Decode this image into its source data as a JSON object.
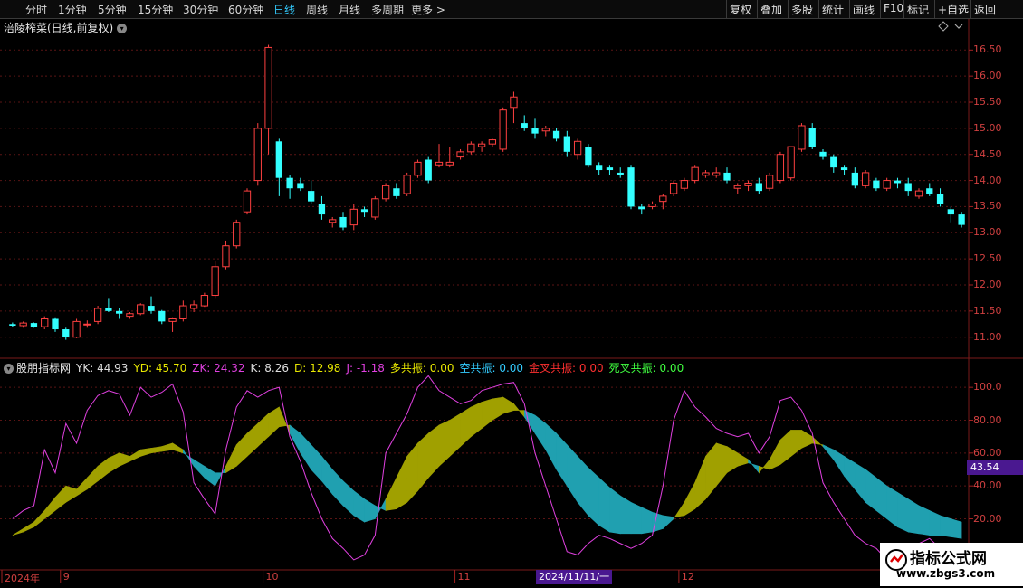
{
  "toolbar": {
    "periods": [
      "分时",
      "1分钟",
      "5分钟",
      "15分钟",
      "30分钟",
      "60分钟",
      "日线",
      "周线",
      "月线",
      "多周期",
      "更多 >"
    ],
    "active_period": "日线",
    "right_buttons": [
      "复权",
      "叠加",
      "多股",
      "统计",
      "画线",
      "F10",
      "标记",
      "+自选",
      "返回"
    ]
  },
  "chart_header": {
    "stock_title": "涪陵榨菜(日线,前复权)"
  },
  "indicator_header": {
    "name": "股朋指标网",
    "items": [
      {
        "label": "YK: 44.93",
        "color": "#e0e0e0"
      },
      {
        "label": "YD: 45.70",
        "color": "#e8e800"
      },
      {
        "label": "ZK: 24.32",
        "color": "#e040e0"
      },
      {
        "label": "K: 8.26",
        "color": "#e0e0e0"
      },
      {
        "label": "D: 12.98",
        "color": "#e8e800"
      },
      {
        "label": "J: -1.18",
        "color": "#e040e0"
      },
      {
        "label": "多共振: 0.00",
        "color": "#e8e800"
      },
      {
        "label": "空共振: 0.00",
        "color": "#33ccff"
      },
      {
        "label": "金叉共振: 0.00",
        "color": "#ff3030"
      },
      {
        "label": "死叉共振: 0.00",
        "color": "#40ff40"
      }
    ],
    "last_value": "43.54"
  },
  "price_axis": [
    "16.50",
    "16.00",
    "15.50",
    "15.00",
    "14.50",
    "14.00",
    "13.50",
    "13.00",
    "12.50",
    "12.00",
    "11.50",
    "11.00"
  ],
  "indicator_axis": [
    "100.0",
    "80.00",
    "60.00",
    "40.00",
    "20.00"
  ],
  "date_axis": {
    "labels": [
      {
        "text": "2024年",
        "bar": 0
      },
      {
        "text": "9",
        "bar": 5
      },
      {
        "text": "10",
        "bar": 24
      },
      {
        "text": "11",
        "bar": 42
      },
      {
        "text": "12",
        "bar": 63
      }
    ],
    "cursor_date": "2024/11/11/一"
  },
  "watermark": {
    "title": "指标公式网",
    "url": "www.zbgs3.com"
  },
  "colors": {
    "up": "#ff4040",
    "down": "#33ffff",
    "grid": "#5a1414",
    "fill_bull": "#a0a000",
    "fill_bear": "#20a0b0",
    "kline": "#e040e0"
  },
  "chart_data": {
    "type": "candlestick",
    "title": "涪陵榨菜(日线,前复权)",
    "ylim": [
      10.7,
      16.8
    ],
    "candles": [
      [
        11.25,
        11.28,
        11.2,
        11.22
      ],
      [
        11.22,
        11.3,
        11.18,
        11.27
      ],
      [
        11.27,
        11.28,
        11.18,
        11.2
      ],
      [
        11.2,
        11.4,
        11.15,
        11.35
      ],
      [
        11.35,
        11.38,
        11.1,
        11.15
      ],
      [
        11.15,
        11.18,
        10.95,
        11.0
      ],
      [
        11.0,
        11.35,
        10.98,
        11.3
      ],
      [
        11.25,
        11.32,
        11.18,
        11.25
      ],
      [
        11.3,
        11.6,
        11.25,
        11.55
      ],
      [
        11.55,
        11.75,
        11.48,
        11.5
      ],
      [
        11.5,
        11.55,
        11.35,
        11.45
      ],
      [
        11.4,
        11.48,
        11.35,
        11.45
      ],
      [
        11.45,
        11.65,
        11.42,
        11.62
      ],
      [
        11.6,
        11.78,
        11.45,
        11.5
      ],
      [
        11.5,
        11.52,
        11.25,
        11.3
      ],
      [
        11.3,
        11.38,
        11.1,
        11.35
      ],
      [
        11.35,
        11.7,
        11.3,
        11.6
      ],
      [
        11.55,
        11.7,
        11.48,
        11.62
      ],
      [
        11.6,
        11.85,
        11.58,
        11.8
      ],
      [
        11.8,
        12.45,
        11.75,
        12.35
      ],
      [
        12.35,
        12.85,
        12.3,
        12.75
      ],
      [
        12.75,
        13.25,
        12.7,
        13.2
      ],
      [
        13.4,
        13.85,
        13.35,
        13.8
      ],
      [
        14.0,
        15.1,
        13.9,
        15.0
      ],
      [
        15.0,
        16.6,
        14.5,
        16.55
      ],
      [
        14.75,
        14.8,
        13.7,
        14.05
      ],
      [
        14.05,
        14.1,
        13.65,
        13.85
      ],
      [
        13.95,
        14.05,
        13.8,
        13.85
      ],
      [
        13.8,
        14.0,
        13.55,
        13.6
      ],
      [
        13.55,
        13.7,
        13.25,
        13.35
      ],
      [
        13.2,
        13.3,
        13.1,
        13.25
      ],
      [
        13.3,
        13.4,
        13.05,
        13.1
      ],
      [
        13.15,
        13.55,
        13.05,
        13.45
      ],
      [
        13.45,
        13.5,
        13.3,
        13.4
      ],
      [
        13.3,
        13.7,
        13.25,
        13.65
      ],
      [
        13.65,
        13.95,
        13.6,
        13.9
      ],
      [
        13.85,
        13.95,
        13.65,
        13.7
      ],
      [
        13.75,
        14.15,
        13.7,
        14.1
      ],
      [
        14.1,
        14.4,
        14.05,
        14.35
      ],
      [
        14.4,
        14.45,
        13.95,
        14.0
      ],
      [
        14.3,
        14.7,
        14.25,
        14.35
      ],
      [
        14.3,
        14.65,
        14.25,
        14.35
      ],
      [
        14.45,
        14.6,
        14.4,
        14.55
      ],
      [
        14.55,
        14.75,
        14.5,
        14.7
      ],
      [
        14.65,
        14.75,
        14.55,
        14.7
      ],
      [
        14.7,
        14.8,
        14.65,
        14.78
      ],
      [
        14.6,
        15.4,
        14.55,
        15.35
      ],
      [
        15.4,
        15.7,
        15.1,
        15.6
      ],
      [
        15.1,
        15.25,
        14.95,
        15.0
      ],
      [
        15.0,
        15.2,
        14.8,
        14.9
      ],
      [
        14.95,
        15.05,
        14.85,
        15.0
      ],
      [
        14.95,
        15.0,
        14.75,
        14.8
      ],
      [
        14.85,
        14.95,
        14.45,
        14.55
      ],
      [
        14.5,
        14.8,
        14.4,
        14.75
      ],
      [
        14.65,
        14.7,
        14.25,
        14.3
      ],
      [
        14.3,
        14.35,
        14.1,
        14.2
      ],
      [
        14.25,
        14.3,
        14.1,
        14.2
      ],
      [
        14.15,
        14.25,
        14.05,
        14.1
      ],
      [
        14.25,
        14.3,
        13.45,
        13.5
      ],
      [
        13.5,
        13.55,
        13.35,
        13.45
      ],
      [
        13.5,
        13.6,
        13.45,
        13.55
      ],
      [
        13.6,
        13.75,
        13.45,
        13.7
      ],
      [
        13.75,
        14.0,
        13.7,
        13.95
      ],
      [
        13.85,
        14.05,
        13.8,
        14.0
      ],
      [
        14.0,
        14.3,
        13.95,
        14.25
      ],
      [
        14.1,
        14.2,
        14.05,
        14.15
      ],
      [
        14.1,
        14.25,
        14.05,
        14.15
      ],
      [
        14.15,
        14.25,
        13.95,
        14.0
      ],
      [
        13.85,
        13.95,
        13.75,
        13.9
      ],
      [
        13.9,
        14.0,
        13.8,
        13.95
      ],
      [
        13.95,
        14.05,
        13.75,
        13.8
      ],
      [
        13.85,
        14.15,
        13.8,
        14.1
      ],
      [
        14.0,
        14.55,
        13.95,
        14.5
      ],
      [
        14.05,
        14.6,
        14.0,
        14.65
      ],
      [
        14.6,
        15.1,
        14.55,
        15.05
      ],
      [
        15.0,
        15.1,
        14.6,
        14.65
      ],
      [
        14.55,
        14.6,
        14.4,
        14.45
      ],
      [
        14.45,
        14.5,
        14.15,
        14.25
      ],
      [
        14.25,
        14.3,
        14.1,
        14.2
      ],
      [
        14.15,
        14.25,
        13.85,
        13.9
      ],
      [
        13.9,
        14.2,
        13.85,
        14.15
      ],
      [
        14.0,
        14.05,
        13.8,
        13.85
      ],
      [
        13.85,
        14.05,
        13.8,
        14.0
      ],
      [
        14.0,
        14.05,
        13.85,
        13.95
      ],
      [
        13.95,
        14.05,
        13.7,
        13.8
      ],
      [
        13.7,
        13.85,
        13.65,
        13.8
      ],
      [
        13.85,
        13.95,
        13.7,
        13.75
      ],
      [
        13.75,
        13.85,
        13.5,
        13.55
      ],
      [
        13.45,
        13.5,
        13.2,
        13.35
      ],
      [
        13.35,
        13.4,
        13.1,
        13.15
      ]
    ],
    "indicator": {
      "ylim": [
        -10,
        110
      ],
      "YK": [
        10,
        14,
        18,
        25,
        33,
        40,
        38,
        45,
        52,
        57,
        60,
        58,
        62,
        63,
        64,
        66,
        62,
        52,
        45,
        40,
        52,
        65,
        72,
        78,
        84,
        88,
        72,
        60,
        50,
        43,
        35,
        28,
        22,
        18,
        20,
        32,
        45,
        58,
        66,
        72,
        77,
        80,
        84,
        88,
        91,
        93,
        94,
        90,
        82,
        72,
        62,
        50,
        40,
        30,
        22,
        16,
        12,
        11,
        11,
        11,
        12,
        14,
        20,
        30,
        42,
        58,
        66,
        64,
        60,
        56,
        48,
        56,
        68,
        74,
        74,
        70,
        64,
        56,
        46,
        38,
        30,
        25,
        20,
        15,
        12,
        11,
        10,
        10,
        9,
        8
      ],
      "YD": [
        10,
        12,
        15,
        20,
        25,
        30,
        34,
        38,
        43,
        48,
        52,
        55,
        58,
        60,
        61,
        62,
        60,
        56,
        52,
        48,
        48,
        52,
        58,
        64,
        70,
        76,
        77,
        72,
        65,
        58,
        50,
        43,
        37,
        32,
        28,
        25,
        26,
        30,
        37,
        45,
        52,
        58,
        64,
        70,
        75,
        80,
        84,
        86,
        86,
        83,
        78,
        72,
        65,
        58,
        51,
        45,
        39,
        34,
        30,
        27,
        24,
        22,
        21,
        22,
        26,
        32,
        40,
        48,
        52,
        54,
        52,
        50,
        53,
        58,
        63,
        66,
        65,
        62,
        58,
        54,
        50,
        45,
        40,
        36,
        32,
        28,
        25,
        22,
        20,
        18
      ],
      "ZK": [
        20,
        25,
        28,
        62,
        48,
        78,
        66,
        86,
        95,
        98,
        96,
        83,
        100,
        94,
        97,
        102,
        85,
        42,
        32,
        23,
        62,
        88,
        98,
        94,
        98,
        100,
        70,
        55,
        36,
        20,
        8,
        2,
        -5,
        -2,
        10,
        60,
        72,
        84,
        100,
        107,
        98,
        94,
        90,
        92,
        98,
        100,
        102,
        103,
        90,
        60,
        40,
        20,
        0,
        -2,
        5,
        10,
        8,
        5,
        2,
        5,
        10,
        40,
        80,
        98,
        88,
        82,
        75,
        72,
        70,
        72,
        60,
        70,
        92,
        94,
        86,
        72,
        42,
        30,
        20,
        10,
        5,
        2,
        -5,
        -2,
        0,
        5,
        8,
        2,
        0,
        -3
      ]
    }
  }
}
